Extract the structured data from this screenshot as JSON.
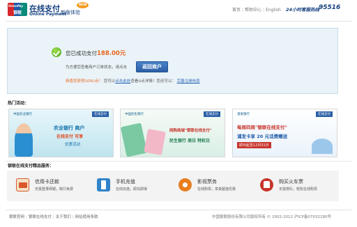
{
  "header": {
    "logo_text_top": "UnionPay",
    "logo_text_bottom": "银联",
    "brand_cn": "在线支付",
    "brand_en": "Online Payment",
    "new_badge": "NEW",
    "new_experience": "新版体验",
    "nav": [
      "首页",
      "帮助中心",
      "English"
    ],
    "hotline_label": "24小时客服热线",
    "hotline_number": "95516"
  },
  "success": {
    "message": "您已成功支付",
    "amount": "188.00元",
    "back_hint": "为方便您查看商户订单状态，请点击",
    "back_button": "返回商户",
    "promo_prefix": "恭喜您获得100U点！",
    "promo_middle": "您可以",
    "promo_link1": "点击此处",
    "promo_suffix": "查看U点详情！您还可以：",
    "promo_link2": "完善注册信息"
  },
  "hot_activities": {
    "title": "热门活动：",
    "banners": [
      {
        "bank": "中国农业银行",
        "tag": "在线支付",
        "line1": "农业银行 商户",
        "line2": "在线支付 可享",
        "line3": "优惠活动"
      },
      {
        "bank": "中国民生银行",
        "tag": "在线支付",
        "line1": "网购商城\"银联在线支付\"",
        "line2": "民生银行 周日 特权日",
        "line3": ""
      },
      {
        "bank": "浦发银行",
        "tag": "在线支付",
        "line1": "每周四周\"银联在线支付\"",
        "line2": "浦发卡享 20 元话费赠送",
        "line3": "即日起至12月31日"
      }
    ]
  },
  "services": {
    "title": "银联在线支付精品服务：",
    "items": [
      {
        "title": "信用卡还款",
        "desc": "无需登录网银，跨行免费",
        "icon": "credit-card-icon",
        "color": "#d9572b"
      },
      {
        "title": "手机充值",
        "desc": "在线充值，即充即得",
        "icon": "mobile-phone-icon",
        "color": "#2f83c9"
      },
      {
        "title": "影视票务",
        "desc": "在线购票，享受超值优惠",
        "icon": "film-reel-icon",
        "color": "#e87e1f"
      },
      {
        "title": "购买火车票",
        "desc": "无需排队，轻松在线购票",
        "icon": "train-icon",
        "color": "#c7342b"
      }
    ]
  },
  "footer": {
    "links": [
      "银联官网",
      "银联在线支付",
      "关于我们",
      "网站使用条款"
    ],
    "copyright": "中国银联股份有限公司版权所有 © 2002-2012 沪ICP备07032180号"
  }
}
